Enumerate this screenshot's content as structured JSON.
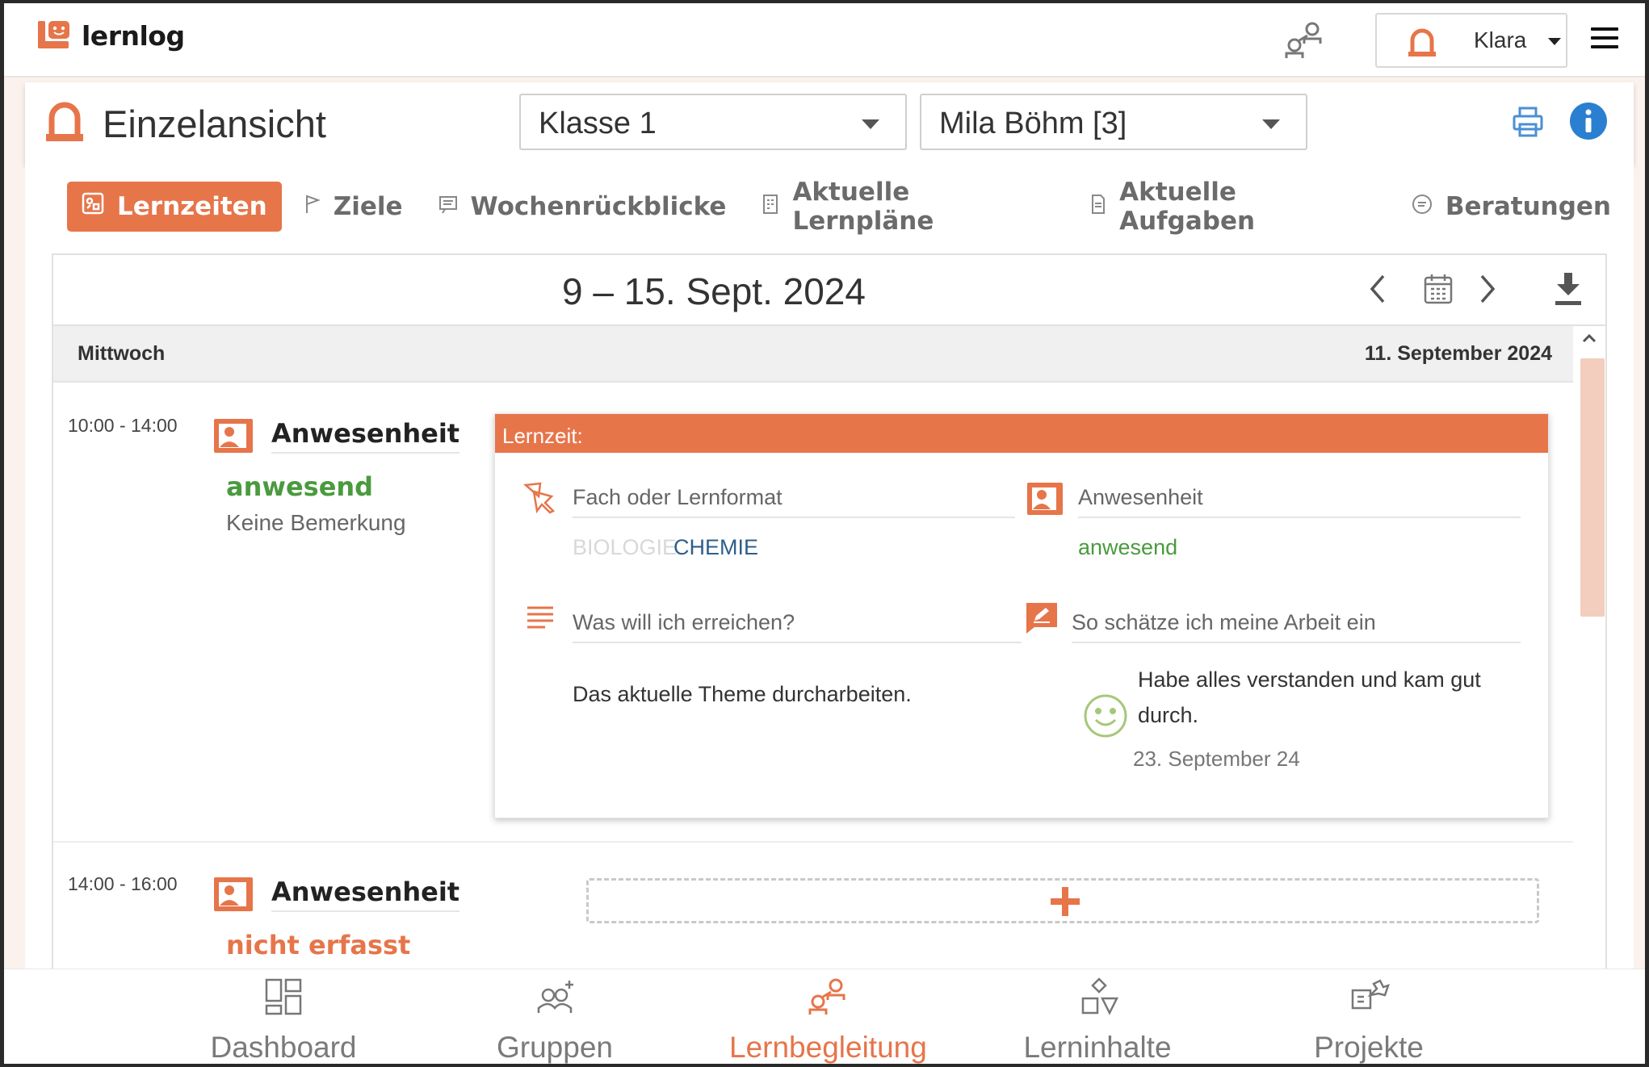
{
  "app": {
    "name": "lernlog"
  },
  "user": {
    "name": "Klara"
  },
  "page": {
    "title": "Einzelansicht"
  },
  "selects": {
    "class": "Klasse 1",
    "student": "Mila Böhm [3]"
  },
  "tabs": [
    {
      "label": "Lernzeiten",
      "icon": "calendar-grid-icon",
      "active": true
    },
    {
      "label": "Ziele",
      "icon": "flag-icon"
    },
    {
      "label": "Wochenrückblicke",
      "icon": "comment-icon"
    },
    {
      "label": "Aktuelle Lernpläne",
      "icon": "plan-icon"
    },
    {
      "label": "Aktuelle Aufgaben",
      "icon": "document-icon"
    },
    {
      "label": "Beratungen",
      "icon": "chat-icon"
    }
  ],
  "week": {
    "title": "9 – 15. Sept. 2024"
  },
  "day": {
    "name": "Mittwoch",
    "date": "11. September 2024"
  },
  "slots": [
    {
      "time": "10:00 - 14:00",
      "label": "Anwesenheit",
      "status": "anwesend",
      "remark": "Keine Bemerkung"
    },
    {
      "time": "14:00 - 16:00",
      "label": "Anwesenheit",
      "status": "nicht erfasst"
    }
  ],
  "lernzeit": {
    "header": "Lernzeit:",
    "subject_label": "Fach oder Lernformat",
    "subjects": [
      "BIOLOGIE",
      "CHEMIE"
    ],
    "attendance_label": "Anwesenheit",
    "attendance_value": "anwesend",
    "goal_label": "Was will ich erreichen?",
    "goal_text": "Das aktuelle Theme durcharbeiten.",
    "assessment_label": "So schätze ich meine Arbeit ein",
    "assessment_text_line1": "Habe alles verstanden und kam gut",
    "assessment_text_line2": "durch.",
    "assessment_date": "23. September 24"
  },
  "bottom_nav": [
    {
      "label": "Dashboard",
      "icon": "dashboard-icon"
    },
    {
      "label": "Gruppen",
      "icon": "groups-icon"
    },
    {
      "label": "Lernbegleitung",
      "icon": "lernbegleitung-icon",
      "active": true
    },
    {
      "label": "Lerninhalte",
      "icon": "shapes-icon"
    },
    {
      "label": "Projekte",
      "icon": "puzzle-icon"
    }
  ],
  "colors": {
    "accent": "#e6754a",
    "present": "#4a9a3e",
    "notRecorded": "#e6754a",
    "info": "#2a7fd0"
  }
}
